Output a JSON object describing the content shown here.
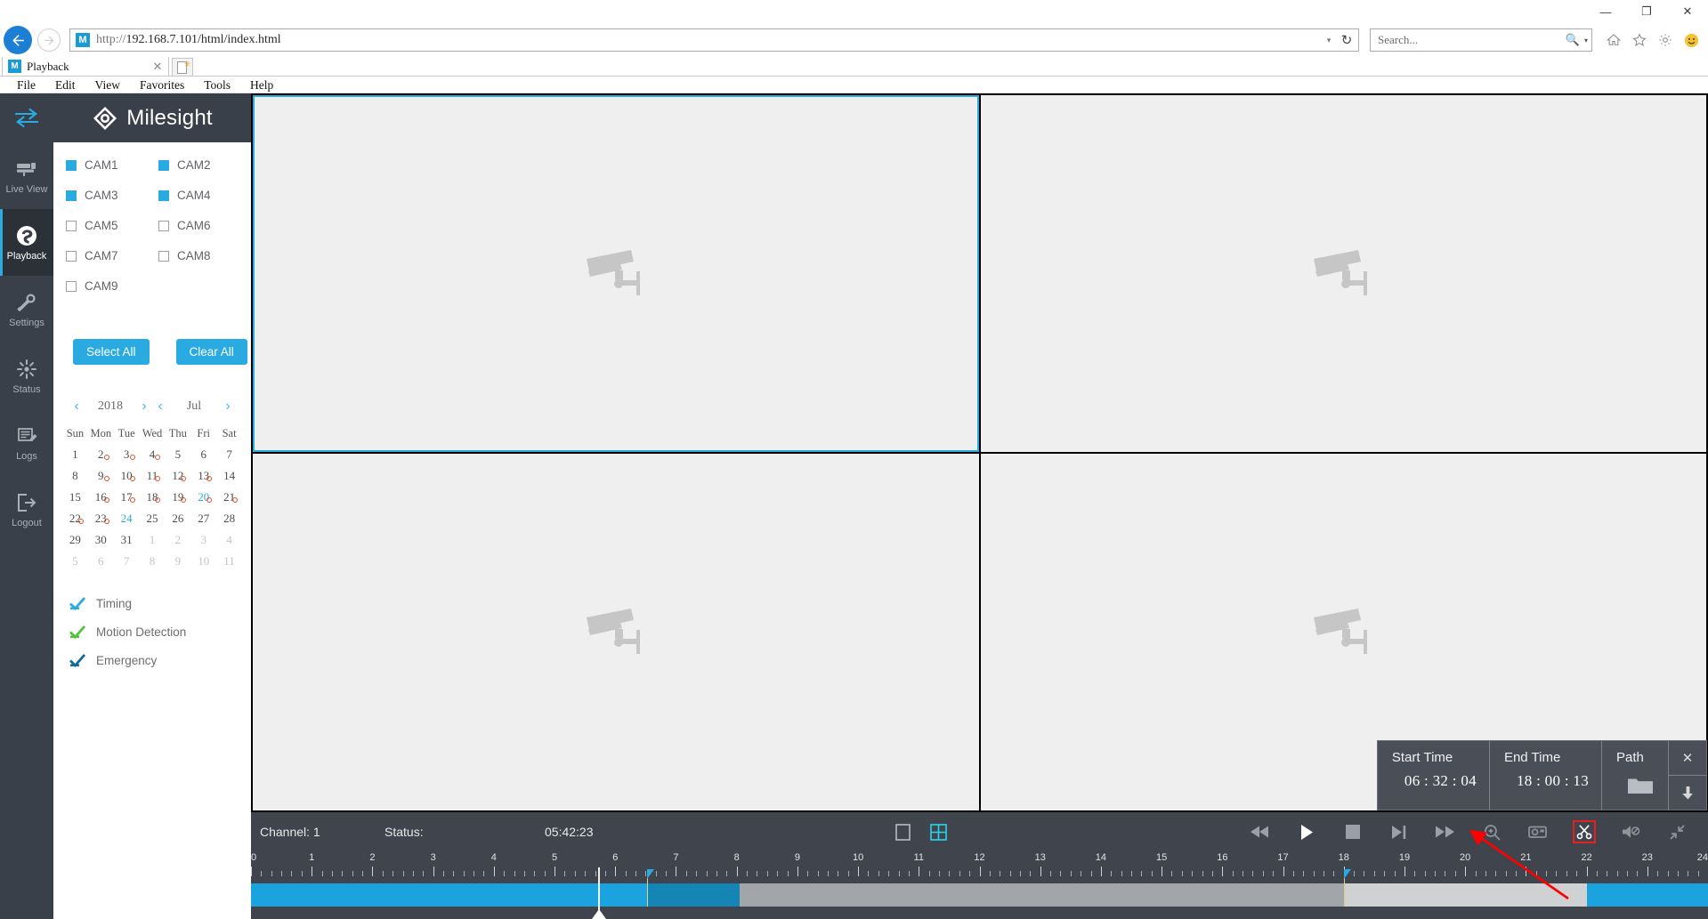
{
  "browser": {
    "window_controls": {
      "minimize": "—",
      "restore": "❐",
      "close": "✕"
    },
    "nav": {
      "back": "back-arrow",
      "forward": "forward-arrow"
    },
    "address": {
      "favicon": "M",
      "protocol": "http://",
      "url": "192.168.7.101/html/index.html",
      "dropdown": "▾",
      "refresh": "↻"
    },
    "search": {
      "placeholder": "Search...",
      "icon": "search-icon",
      "caret": "▾"
    },
    "toolbar_icons": [
      "home-icon",
      "favorites-star-icon",
      "gear-icon",
      "smiley-icon"
    ],
    "tab": {
      "favicon": "M",
      "title": "Playback",
      "close": "✕"
    },
    "new_tab": "new-tab-button",
    "menu": [
      "File",
      "Edit",
      "View",
      "Favorites",
      "Tools",
      "Help"
    ]
  },
  "rail": {
    "toggle": "collapse-sidebar-toggle",
    "items": [
      {
        "label": "Live View",
        "icon": "live-view-icon",
        "active": false
      },
      {
        "label": "Playback",
        "icon": "playback-icon",
        "active": true
      },
      {
        "label": "Settings",
        "icon": "settings-icon",
        "active": false
      },
      {
        "label": "Status",
        "icon": "status-icon",
        "active": false
      },
      {
        "label": "Logs",
        "icon": "logs-icon",
        "active": false
      },
      {
        "label": "Logout",
        "icon": "logout-icon",
        "active": false
      }
    ]
  },
  "brand": {
    "name": "Milesight",
    "logo": "milesight-logo"
  },
  "cameras": [
    {
      "label": "CAM1",
      "checked": true
    },
    {
      "label": "CAM2",
      "checked": true
    },
    {
      "label": "CAM3",
      "checked": true
    },
    {
      "label": "CAM4",
      "checked": true
    },
    {
      "label": "CAM5",
      "checked": false
    },
    {
      "label": "CAM6",
      "checked": false
    },
    {
      "label": "CAM7",
      "checked": false
    },
    {
      "label": "CAM8",
      "checked": false
    },
    {
      "label": "CAM9",
      "checked": false
    }
  ],
  "buttons": {
    "select_all": "Select All",
    "clear_all": "Clear All"
  },
  "calendar": {
    "year": "2018",
    "month": "Jul",
    "prev": "‹",
    "next": "›",
    "dow": [
      "Sun",
      "Mon",
      "Tue",
      "Wed",
      "Thu",
      "Fri",
      "Sat"
    ],
    "weeks": [
      [
        {
          "d": "1"
        },
        {
          "d": "2",
          "dot": true
        },
        {
          "d": "3",
          "dot": true
        },
        {
          "d": "4",
          "dot": true
        },
        {
          "d": "5"
        },
        {
          "d": "6"
        },
        {
          "d": "7"
        }
      ],
      [
        {
          "d": "8"
        },
        {
          "d": "9",
          "dot": true
        },
        {
          "d": "10",
          "dot": true
        },
        {
          "d": "11",
          "dot": true
        },
        {
          "d": "12",
          "dot": true
        },
        {
          "d": "13",
          "dot": true
        },
        {
          "d": "14"
        }
      ],
      [
        {
          "d": "15"
        },
        {
          "d": "16",
          "dot": true
        },
        {
          "d": "17",
          "dot": true
        },
        {
          "d": "18",
          "dot": true
        },
        {
          "d": "19",
          "dot": true
        },
        {
          "d": "20",
          "dot": true,
          "sel": true
        },
        {
          "d": "21",
          "dot": true
        }
      ],
      [
        {
          "d": "22",
          "dot": true
        },
        {
          "d": "23",
          "dot": true
        },
        {
          "d": "24",
          "sel": true
        },
        {
          "d": "25"
        },
        {
          "d": "26"
        },
        {
          "d": "27"
        },
        {
          "d": "28"
        }
      ],
      [
        {
          "d": "29"
        },
        {
          "d": "30"
        },
        {
          "d": "31"
        },
        {
          "d": "1",
          "out": true
        },
        {
          "d": "2",
          "out": true
        },
        {
          "d": "3",
          "out": true
        },
        {
          "d": "4",
          "out": true
        }
      ],
      [
        {
          "d": "5",
          "out": true
        },
        {
          "d": "6",
          "out": true
        },
        {
          "d": "7",
          "out": true
        },
        {
          "d": "8",
          "out": true
        },
        {
          "d": "9",
          "out": true
        },
        {
          "d": "10",
          "out": true
        },
        {
          "d": "11",
          "out": true
        }
      ]
    ]
  },
  "legend": [
    {
      "label": "Timing",
      "color": "#29abe2"
    },
    {
      "label": "Motion Detection",
      "color": "#52c23a"
    },
    {
      "label": "Emergency",
      "color": "#136c95"
    }
  ],
  "video": {
    "cells": [
      {
        "name": "cell-1",
        "selected": true,
        "placeholder": "camera-icon"
      },
      {
        "name": "cell-2",
        "selected": false,
        "placeholder": "camera-icon"
      },
      {
        "name": "cell-3",
        "selected": false,
        "placeholder": "camera-icon"
      },
      {
        "name": "cell-4",
        "selected": false,
        "placeholder": "camera-icon"
      }
    ]
  },
  "controls": {
    "channel": "Channel: 1",
    "status": "Status:",
    "time": "05:42:23",
    "layout_single": "single-view-icon",
    "layout_quad": "quad-view-icon",
    "playback_buttons": [
      {
        "name": "rewind-button",
        "icon": "rewind"
      },
      {
        "name": "play-button",
        "icon": "play"
      },
      {
        "name": "stop-button",
        "icon": "stop"
      },
      {
        "name": "frame-step-button",
        "icon": "step"
      },
      {
        "name": "fast-forward-button",
        "icon": "fast-forward"
      },
      {
        "name": "zoom-button",
        "icon": "magnifier-plus"
      },
      {
        "name": "snapshot-button",
        "icon": "camera"
      },
      {
        "name": "clip-button",
        "icon": "scissors",
        "highlighted": true
      },
      {
        "name": "mute-button",
        "icon": "speaker-muted"
      },
      {
        "name": "exit-fullscreen-button",
        "icon": "shrink-arrows"
      }
    ]
  },
  "clip_panel": {
    "start_label": "Start Time",
    "start_value": "06 : 32 : 04",
    "end_label": "End Time",
    "end_value": "18 : 00 : 13",
    "path_label": "Path",
    "path_icon": "folder-icon",
    "close": "✕",
    "download": "↓"
  },
  "timeline": {
    "ticks": [
      "0",
      "1",
      "2",
      "3",
      "4",
      "5",
      "6",
      "7",
      "8",
      "9",
      "10",
      "11",
      "12",
      "13",
      "14",
      "15",
      "16",
      "17",
      "18",
      "19",
      "20",
      "21",
      "22",
      "23",
      "24"
    ],
    "range_start": 0,
    "range_end": 24,
    "playhead_hour": 5.72,
    "mark_hours": [
      6.52,
      18.0
    ],
    "segments": [
      {
        "from": 0.0,
        "to": 6.52,
        "color": "#1ba3e0",
        "name": "recorded-timing"
      },
      {
        "from": 6.52,
        "to": 8.05,
        "color": "#1585b5",
        "name": "recorded-emergency"
      },
      {
        "from": 8.05,
        "to": 18.0,
        "color": "#a3a6a8",
        "name": "recorded-grey-a"
      },
      {
        "from": 18.0,
        "to": 22.0,
        "color": "#cfd1d2",
        "name": "recorded-grey-b"
      },
      {
        "from": 22.0,
        "to": 24.0,
        "color": "#1ba3e0",
        "name": "recorded-timing-b"
      }
    ],
    "annotation_arrow": {
      "color": "#ff0000",
      "points_to": "clip-button"
    }
  }
}
